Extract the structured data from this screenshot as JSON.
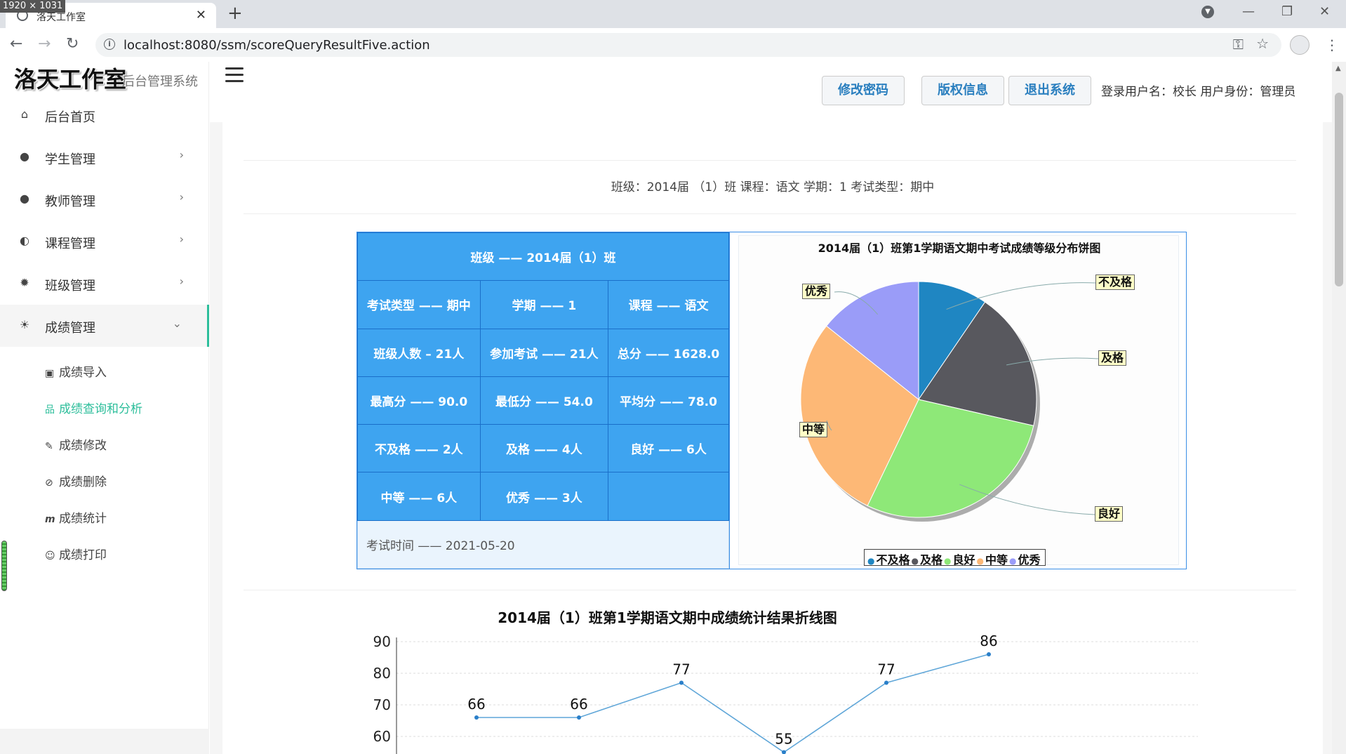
{
  "browser": {
    "size_badge": "1920 × 1031",
    "tab_title": "洛天工作室",
    "url": "localhost:8080/ssm/scoreQueryResultFive.action"
  },
  "sidebar": {
    "logo": "洛天工作室",
    "logo_sub": "后台管理系统",
    "items": [
      {
        "label": "后台首页",
        "icon": "home-icon"
      },
      {
        "label": "学生管理",
        "icon": "user-icon"
      },
      {
        "label": "教师管理",
        "icon": "user-icon"
      },
      {
        "label": "课程管理",
        "icon": "toggle-icon"
      },
      {
        "label": "班级管理",
        "icon": "gear-icon"
      },
      {
        "label": "成绩管理",
        "icon": "bulb-icon"
      }
    ],
    "subitems": [
      {
        "label": "成绩导入",
        "icon": "message-icon"
      },
      {
        "label": "成绩查询和分析",
        "icon": "sitemap-icon"
      },
      {
        "label": "成绩修改",
        "icon": "edit-icon"
      },
      {
        "label": "成绩删除",
        "icon": "ban-icon"
      },
      {
        "label": "成绩统计",
        "icon": "m-icon"
      },
      {
        "label": "成绩打印",
        "icon": "smile-icon"
      }
    ]
  },
  "header": {
    "btn_password": "修改密码",
    "btn_copyright": "版权信息",
    "btn_logout": "退出系统",
    "user_info": "登录用户名：校长 用户身份：管理员"
  },
  "query": {
    "info": "班级：2014届 （1）班    课程：语文    学期：1    考试类型：期中"
  },
  "stats": {
    "class": "班级 —— 2014届（1）班",
    "exam_type": "考试类型 —— 期中",
    "term": "学期 —— 1",
    "course": "课程 —— 语文",
    "class_count": "班级人数 – 21人",
    "attend": "参加考试 —— 21人",
    "total": "总分 —— 1628.0",
    "max": "最高分 —— 90.0",
    "min": "最低分 —— 54.0",
    "avg": "平均分 —— 78.0",
    "fail": "不及格 —— 2人",
    "pass": "及格 —— 4人",
    "good": "良好 —— 6人",
    "medium": "中等 —— 6人",
    "excellent": "优秀 —— 3人",
    "exam_time": "考试时间 —— 2021-05-20"
  },
  "chart_data": [
    {
      "type": "pie",
      "title": "2014届（1）班第1学期语文期中考试成绩等级分布饼图",
      "categories": [
        "不及格",
        "及格",
        "良好",
        "中等",
        "优秀"
      ],
      "values": [
        2,
        4,
        6,
        6,
        3
      ],
      "colors": [
        "#1f86c2",
        "#58585e",
        "#8ee878",
        "#fdb876",
        "#9a9cf8"
      ],
      "legend": "bottom"
    },
    {
      "type": "line",
      "title": "2014届（1）班第1学期语文期中成绩统计结果折线图",
      "y_ticks": [
        "90",
        "80",
        "70",
        "60"
      ],
      "values": [
        66,
        66,
        77,
        55,
        77,
        86
      ],
      "value_labels": [
        "66",
        "66",
        "77",
        "55",
        "77",
        "86"
      ],
      "color": "#5fa6d8"
    }
  ]
}
